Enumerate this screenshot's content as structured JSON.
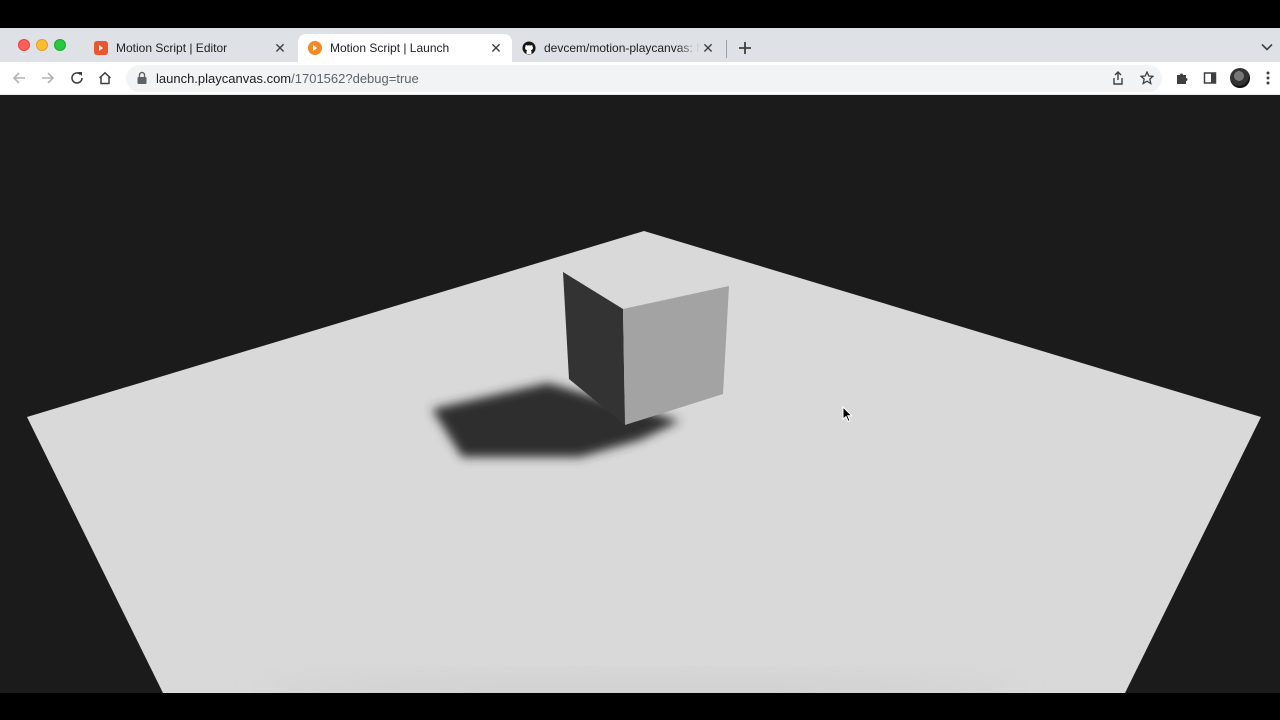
{
  "browser": {
    "tabs": [
      {
        "title": "Motion Script | Editor",
        "active": false,
        "favicon": "playcanvas-editor-icon",
        "favicon_color": "#e8572e"
      },
      {
        "title": "Motion Script | Launch",
        "active": true,
        "favicon": "playcanvas-launch-icon",
        "favicon_color": "#f08a24"
      },
      {
        "title": "devcem/motion-playcanvas: Mo",
        "active": false,
        "favicon": "github-icon",
        "favicon_color": "#181717"
      }
    ],
    "address_bar": {
      "host": "launch.playcanvas.com",
      "path": "/1701562?debug=true"
    }
  },
  "toolbar_icons": [
    "back-icon",
    "forward-icon",
    "reload-icon",
    "home-icon",
    "lock-icon",
    "share-icon",
    "star-icon",
    "extensions-icon",
    "side-panel-icon",
    "avatar",
    "menu-icon"
  ],
  "scene": {
    "background_color": "#1b1b1b",
    "ground_color": "#d9d9d9",
    "shadow_color": "#2e2e2e",
    "cube_left_face_color": "#333333",
    "cube_right_face_color": "#a3a3a3"
  }
}
